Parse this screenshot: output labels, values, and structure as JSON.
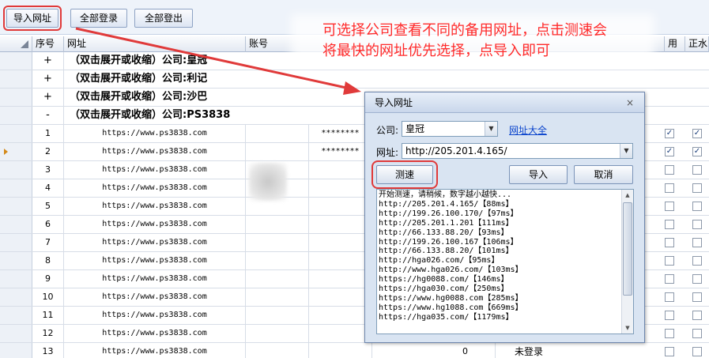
{
  "toolbar": {
    "import_label": "导入网址",
    "login_all_label": "全部登录",
    "logout_all_label": "全部登出"
  },
  "grid": {
    "headers": {
      "seq": "序号",
      "url": "网址",
      "account": "账号",
      "use": "用",
      "stop": "正水"
    },
    "groups": [
      {
        "sign": "+",
        "title": "（双击展开或收缩）公司:皇冠"
      },
      {
        "sign": "+",
        "title": "（双击展开或收缩）公司:利记"
      },
      {
        "sign": "+",
        "title": "（双击展开或收缩）公司:沙巴"
      },
      {
        "sign": "-",
        "title": "（双击展开或收缩）公司:PS3838"
      }
    ],
    "rows": [
      {
        "n": "1",
        "url": "https://www.ps3838.com",
        "account": "********",
        "use": true,
        "stop": true
      },
      {
        "n": "2",
        "url": "https://www.ps3838.com",
        "account": "********",
        "use": true,
        "stop": true
      },
      {
        "n": "3",
        "url": "https://www.ps3838.com",
        "account": "",
        "use": false,
        "stop": false
      },
      {
        "n": "4",
        "url": "https://www.ps3838.com",
        "account": "",
        "use": false,
        "stop": false
      },
      {
        "n": "5",
        "url": "https://www.ps3838.com",
        "account": "",
        "use": false,
        "stop": false
      },
      {
        "n": "6",
        "url": "https://www.ps3838.com",
        "account": "",
        "use": false,
        "stop": false
      },
      {
        "n": "7",
        "url": "https://www.ps3838.com",
        "account": "",
        "use": false,
        "stop": false
      },
      {
        "n": "8",
        "url": "https://www.ps3838.com",
        "account": "",
        "use": false,
        "stop": false
      },
      {
        "n": "9",
        "url": "https://www.ps3838.com",
        "account": "",
        "use": false,
        "stop": false
      },
      {
        "n": "10",
        "url": "https://www.ps3838.com",
        "account": "",
        "use": false,
        "stop": false
      },
      {
        "n": "11",
        "url": "https://www.ps3838.com",
        "account": "",
        "use": false,
        "stop": false
      },
      {
        "n": "12",
        "url": "https://www.ps3838.com",
        "account": "",
        "use": false,
        "stop": false
      },
      {
        "n": "13",
        "url": "https://www.ps3838.com",
        "account": "",
        "use": false,
        "stop": false,
        "balance": "0",
        "status": "未登录"
      }
    ]
  },
  "annotation": {
    "line1": "可选择公司查看不同的备用网址，点击测速会",
    "line2": "将最快的网址优先选择，点导入即可"
  },
  "dialog": {
    "title": "导入网址",
    "close": "×",
    "company_label": "公司:",
    "company_value": "皇冠",
    "url_link": "网址大全",
    "url_label": "网址:",
    "url_value": "http://205.201.4.165/",
    "speed_test": "测速",
    "import": "导入",
    "cancel": "取消",
    "log": [
      "开始测速，请稍候，数字越小越快...",
      "http://205.201.4.165/【88ms】",
      "http://199.26.100.170/【97ms】",
      "http://205.201.1.201【111ms】",
      "http://66.133.88.20/【93ms】",
      "http://199.26.100.167【106ms】",
      "http://66.133.88.20/【101ms】",
      "http://hga026.com/【95ms】",
      "http://www.hga026.com/【103ms】",
      "https://hg0088.com/【146ms】",
      "https://hga030.com/【250ms】",
      "https://www.hg0088.com【285ms】",
      "https://www.hg1088.com【669ms】",
      "https://hga035.com/【1179ms】"
    ]
  },
  "colors": {
    "annotation": "#ff2a2a",
    "highlight": "#e03a3a",
    "link": "#0b44cc"
  }
}
